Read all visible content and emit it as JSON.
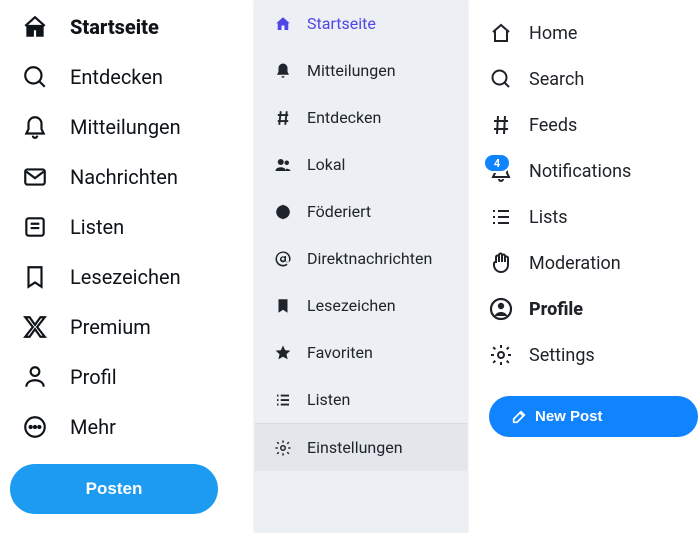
{
  "col1": {
    "items": [
      {
        "label": "Startseite",
        "icon": "home",
        "active": true
      },
      {
        "label": "Entdecken",
        "icon": "search"
      },
      {
        "label": "Mitteilungen",
        "icon": "bell"
      },
      {
        "label": "Nachrichten",
        "icon": "mail"
      },
      {
        "label": "Listen",
        "icon": "list"
      },
      {
        "label": "Lesezeichen",
        "icon": "bookmark"
      },
      {
        "label": "Premium",
        "icon": "x"
      },
      {
        "label": "Profil",
        "icon": "person"
      },
      {
        "label": "Mehr",
        "icon": "more"
      }
    ],
    "post_label": "Posten"
  },
  "col2": {
    "items": [
      {
        "label": "Startseite",
        "icon": "home",
        "active": true
      },
      {
        "label": "Mitteilungen",
        "icon": "bell"
      },
      {
        "label": "Entdecken",
        "icon": "hash"
      },
      {
        "label": "Lokal",
        "icon": "users"
      },
      {
        "label": "Föderiert",
        "icon": "globe"
      },
      {
        "label": "Direktnachrichten",
        "icon": "at"
      },
      {
        "label": "Lesezeichen",
        "icon": "bookmark"
      },
      {
        "label": "Favoriten",
        "icon": "star"
      },
      {
        "label": "Listen",
        "icon": "list"
      }
    ],
    "settings_label": "Einstellungen"
  },
  "col3": {
    "items": [
      {
        "label": "Home",
        "icon": "home"
      },
      {
        "label": "Search",
        "icon": "search"
      },
      {
        "label": "Feeds",
        "icon": "hash"
      },
      {
        "label": "Notifications",
        "icon": "bell",
        "badge": "4"
      },
      {
        "label": "Lists",
        "icon": "list"
      },
      {
        "label": "Moderation",
        "icon": "hand"
      },
      {
        "label": "Profile",
        "icon": "user",
        "active": true
      },
      {
        "label": "Settings",
        "icon": "gear"
      }
    ],
    "newpost_label": "New Post"
  }
}
